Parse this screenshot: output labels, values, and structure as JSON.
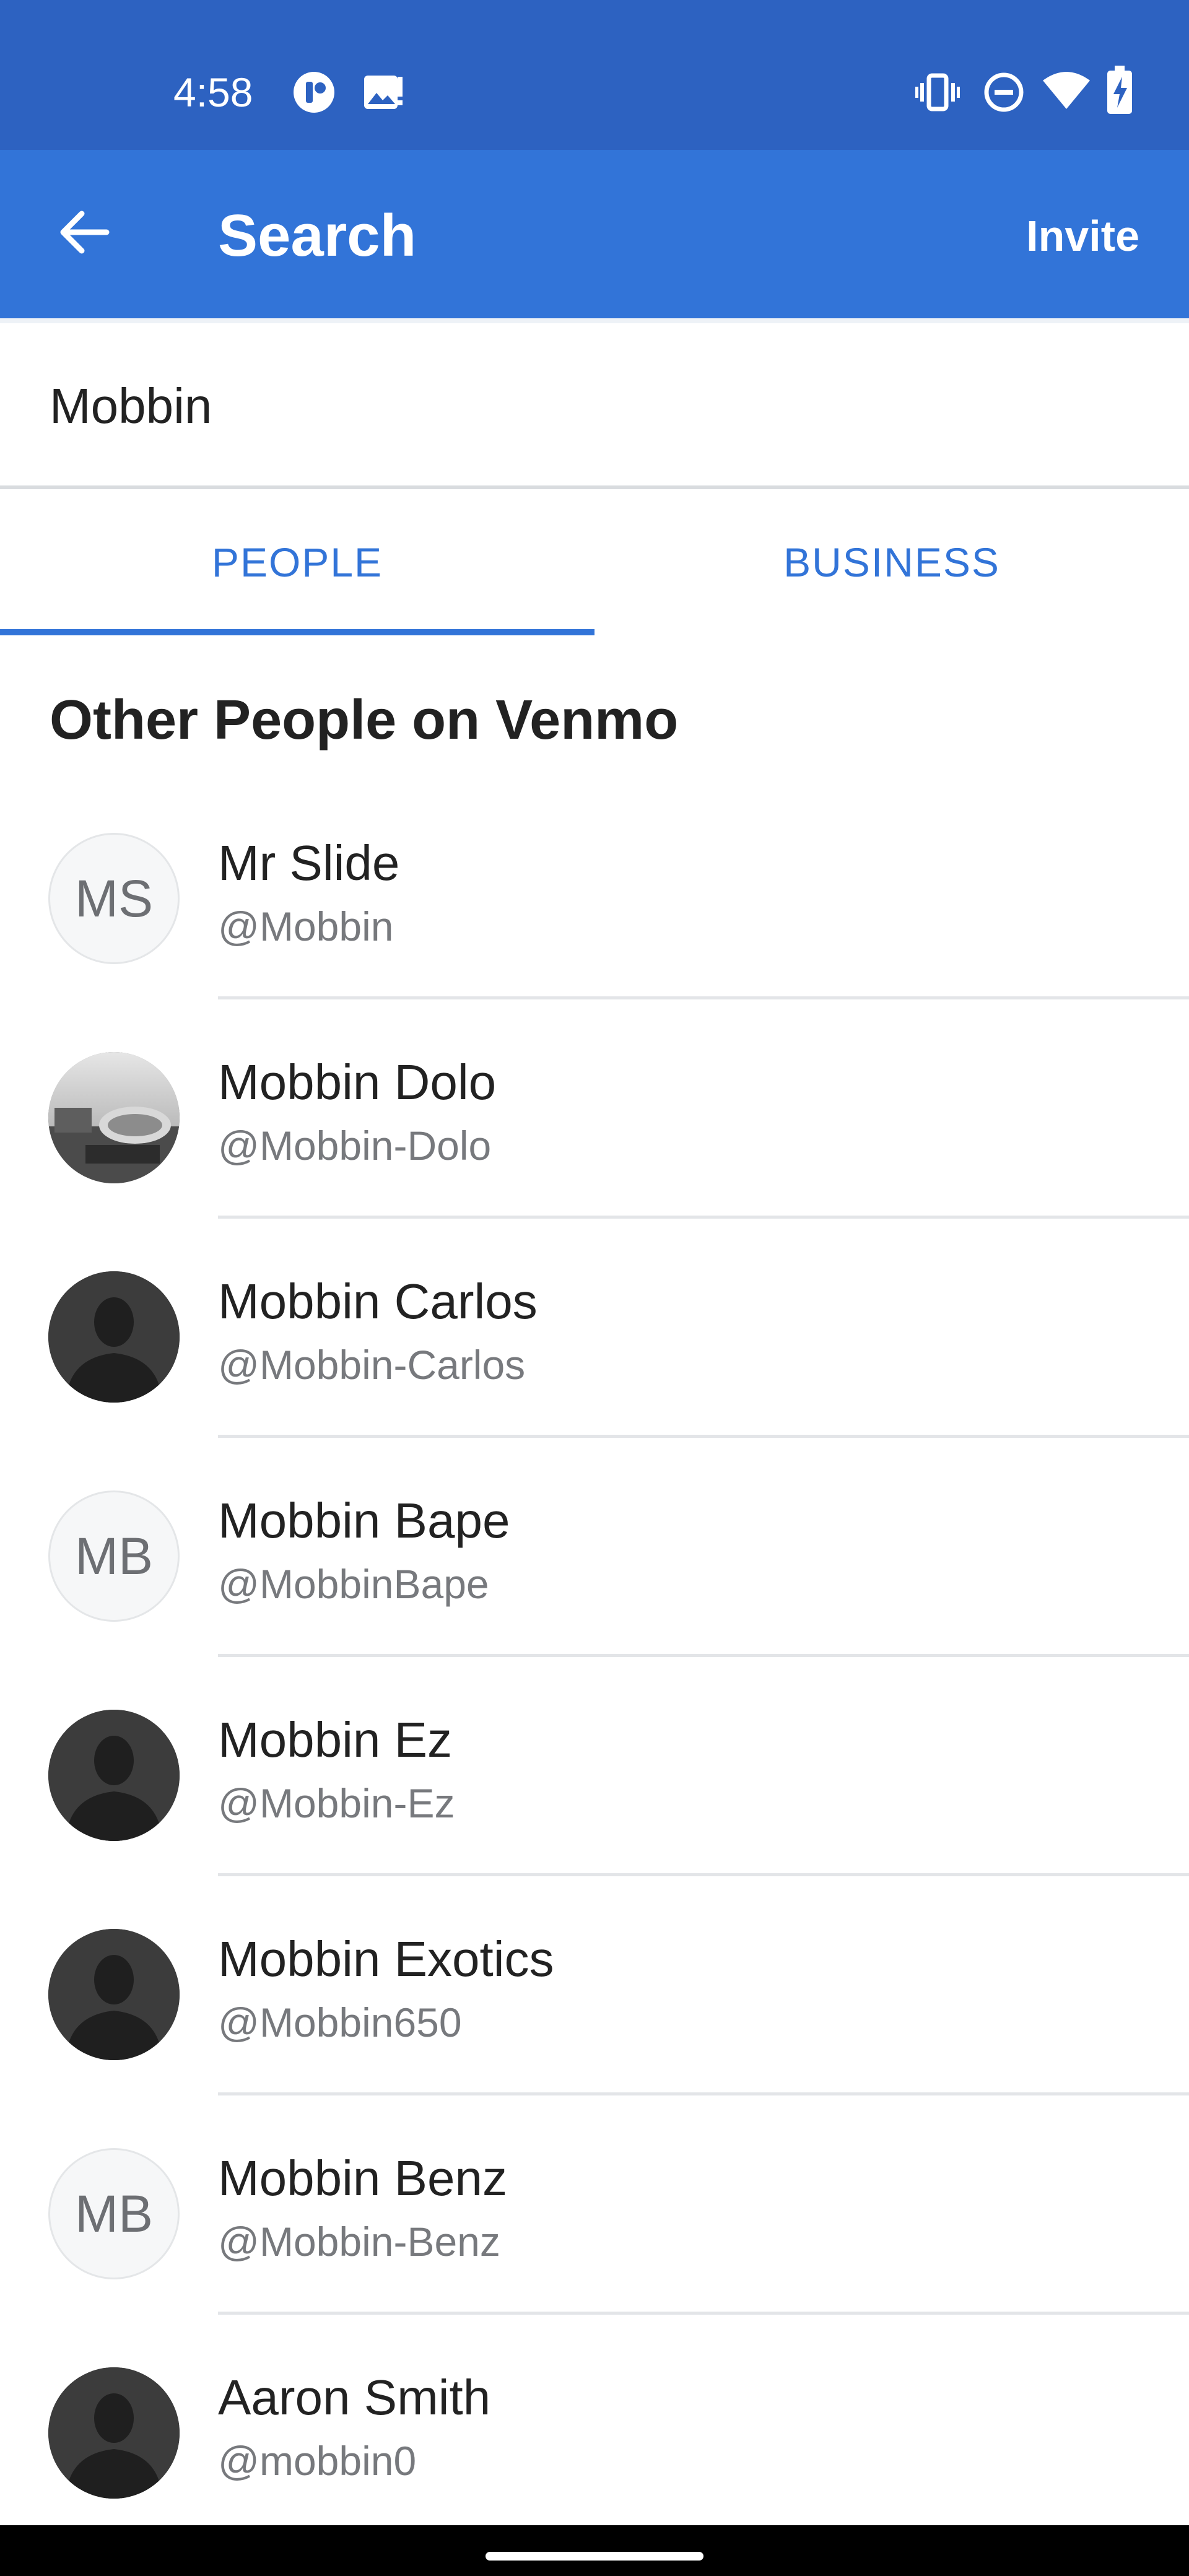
{
  "status_bar": {
    "time": "4:58",
    "icons": [
      "notification-app-icon",
      "image-alert-icon",
      "vibrate-icon",
      "do-not-disturb-icon",
      "wifi-icon",
      "battery-charging-icon"
    ]
  },
  "app_bar": {
    "title": "Search",
    "back_icon": "arrow-left-icon",
    "invite_label": "Invite"
  },
  "search": {
    "value": "Mobbin"
  },
  "tabs": [
    {
      "label": "PEOPLE",
      "selected": true
    },
    {
      "label": "BUSINESS",
      "selected": false
    }
  ],
  "section_title": "Other People on Venmo",
  "results": [
    {
      "name": "Mr Slide",
      "handle": "@Mobbin",
      "avatar_type": "initials",
      "initials": "MS"
    },
    {
      "name": "Mobbin Dolo",
      "handle": "@Mobbin-Dolo",
      "avatar_type": "photo",
      "initials": ""
    },
    {
      "name": "Mobbin Carlos",
      "handle": "@Mobbin-Carlos",
      "avatar_type": "silhouette",
      "initials": ""
    },
    {
      "name": "Mobbin Bape",
      "handle": "@MobbinBape",
      "avatar_type": "initials",
      "initials": "MB"
    },
    {
      "name": "Mobbin Ez",
      "handle": "@Mobbin-Ez",
      "avatar_type": "silhouette",
      "initials": ""
    },
    {
      "name": "Mobbin Exotics",
      "handle": "@Mobbin650",
      "avatar_type": "silhouette",
      "initials": ""
    },
    {
      "name": "Mobbin Benz",
      "handle": "@Mobbin-Benz",
      "avatar_type": "initials",
      "initials": "MB"
    },
    {
      "name": "Aaron Smith",
      "handle": "@mobbin0",
      "avatar_type": "silhouette",
      "initials": ""
    }
  ],
  "colors": {
    "status_bar": "#2d62c1",
    "app_bar": "#3274d8",
    "accent": "#3274d8",
    "text_primary": "#222222",
    "text_secondary": "#77797d"
  }
}
